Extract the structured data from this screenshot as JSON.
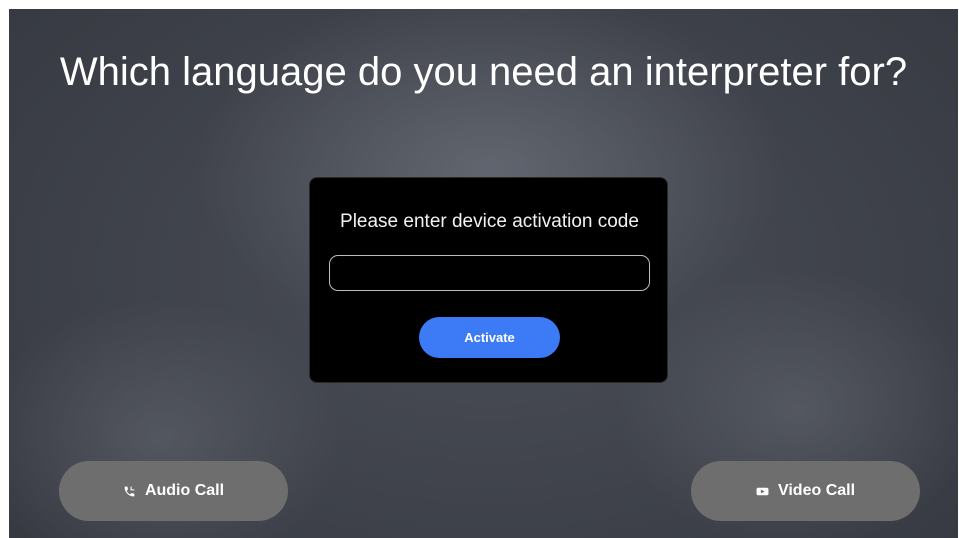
{
  "title": "Which language do you need an interpreter for?",
  "activation": {
    "label": "Please enter device activation code",
    "input_value": "",
    "input_placeholder": "",
    "activate_label": "Activate"
  },
  "calls": {
    "audio": {
      "label": "Audio Call",
      "icon": "phone-icon"
    },
    "video": {
      "label": "Video Call",
      "icon": "video-camera-icon"
    }
  },
  "colors": {
    "activate_button": "#3d7bf6",
    "call_button": "#6e6e6e",
    "dialog_background": "#000000",
    "text": "#ffffff"
  }
}
